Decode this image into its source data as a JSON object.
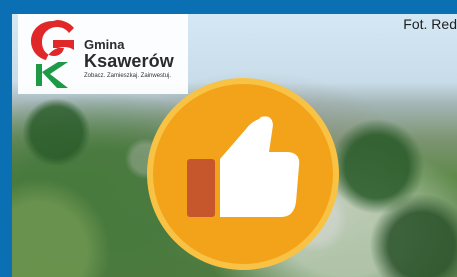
{
  "branding": {
    "line1": "Gmina",
    "line2": "Ksawerów",
    "tagline": "Zobacz. Zamieszkaj. Zainwestuj."
  },
  "photo": {
    "credit": "Fot. Red"
  },
  "icons": {
    "logo": "municipality-logo",
    "thumb": "thumbs-up-icon"
  },
  "colors": {
    "frame": "#0b6fb3",
    "thumb_badge": "#f2a31a",
    "thumb_badge_ring": "#f8c344",
    "thumb_cuff": "#c6572d"
  }
}
